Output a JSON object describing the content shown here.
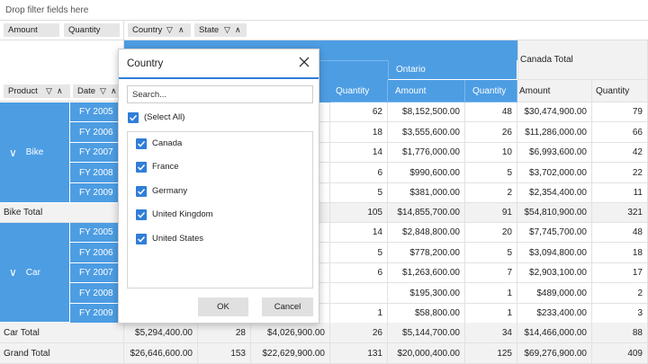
{
  "drop_filter_text": "Drop filter fields here",
  "values_fields": [
    "Amount",
    "Quantity"
  ],
  "column_fields": [
    "Country",
    "State"
  ],
  "row_fields": [
    "Product",
    "Date"
  ],
  "column_headers": {
    "country_partial": "",
    "state_ontario": "Ontario",
    "canada_total": "Canada Total",
    "measure_quantity": "Quantity",
    "measure_amount": "Amount"
  },
  "rows": [
    {
      "product": "Bike",
      "date": "FY 2005",
      "q1": "62",
      "ont_amount": "$8,152,500.00",
      "ont_qty": "48",
      "tot_amount": "$30,474,900.00",
      "tot_qty": "79"
    },
    {
      "product": "",
      "date": "FY 2006",
      "q1": "18",
      "ont_amount": "$3,555,600.00",
      "ont_qty": "26",
      "tot_amount": "$11,286,000.00",
      "tot_qty": "66"
    },
    {
      "product": "",
      "date": "FY 2007",
      "q1": "14",
      "ont_amount": "$1,776,000.00",
      "ont_qty": "10",
      "tot_amount": "$6,993,600.00",
      "tot_qty": "42"
    },
    {
      "product": "",
      "date": "FY 2008",
      "q1": "6",
      "ont_amount": "$990,600.00",
      "ont_qty": "5",
      "tot_amount": "$3,702,000.00",
      "tot_qty": "22"
    },
    {
      "product": "",
      "date": "FY 2009",
      "q1": "5",
      "ont_amount": "$381,000.00",
      "ont_qty": "2",
      "tot_amount": "$2,354,400.00",
      "tot_qty": "11"
    }
  ],
  "bike_total": {
    "label": "Bike Total",
    "q1": "105",
    "ont_amount": "$14,855,700.00",
    "ont_qty": "91",
    "tot_amount": "$54,810,900.00",
    "tot_qty": "321"
  },
  "car_rows": [
    {
      "date": "FY 2005",
      "q1": "14",
      "ont_amount": "$2,848,800.00",
      "ont_qty": "20",
      "tot_amount": "$7,745,700.00",
      "tot_qty": "48"
    },
    {
      "date": "FY 2006",
      "q1": "5",
      "ont_amount": "$778,200.00",
      "ont_qty": "5",
      "tot_amount": "$3,094,800.00",
      "tot_qty": "18"
    },
    {
      "date": "FY 2007",
      "q1": "6",
      "ont_amount": "$1,263,600.00",
      "ont_qty": "7",
      "tot_amount": "$2,903,100.00",
      "tot_qty": "17"
    },
    {
      "date": "FY 2008",
      "q1": "",
      "ont_amount": "$195,300.00",
      "ont_qty": "1",
      "tot_amount": "$489,000.00",
      "tot_qty": "2"
    },
    {
      "date": "FY 2009",
      "q1": "1",
      "ont_amount": "$58,800.00",
      "ont_qty": "1",
      "tot_amount": "$233,400.00",
      "tot_qty": "3"
    }
  ],
  "car_label": "Car",
  "car_total": {
    "label": "Car Total",
    "a1": "$5,294,400.00",
    "q0": "28",
    "a2": "$4,026,900.00",
    "q1": "26",
    "ont_amount": "$5,144,700.00",
    "ont_qty": "34",
    "tot_amount": "$14,466,000.00",
    "tot_qty": "88"
  },
  "grand_total": {
    "label": "Grand Total",
    "a1": "$26,646,600.00",
    "q0": "153",
    "a2": "$22,629,900.00",
    "q1": "131",
    "ont_amount": "$20,000,400.00",
    "ont_qty": "125",
    "tot_amount": "$69,276,900.00",
    "tot_qty": "409"
  },
  "dialog": {
    "title": "Country",
    "search_placeholder": "Search...",
    "select_all": "(Select All)",
    "items": [
      "Canada",
      "France",
      "Germany",
      "United Kingdom",
      "United States"
    ],
    "ok": "OK",
    "cancel": "Cancel"
  },
  "colors": {
    "header_blue": "#4d9de3",
    "checkbox_blue": "#2f7ed8"
  }
}
